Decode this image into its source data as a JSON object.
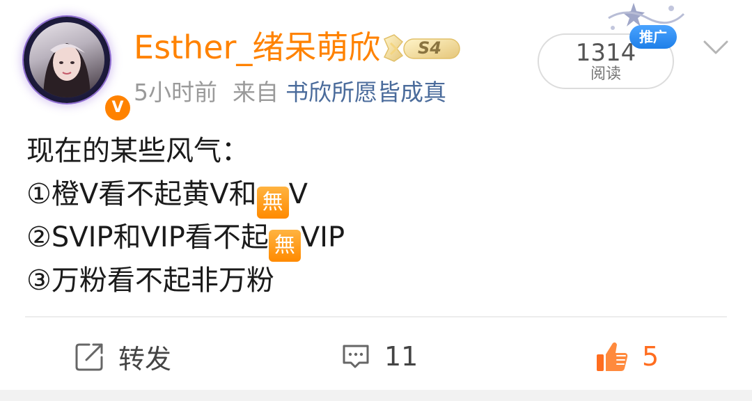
{
  "post": {
    "author": {
      "name": "Esther_绪呆萌欣",
      "level_badge": "S4",
      "verified_mark": "V"
    },
    "meta": {
      "time": "5小时前",
      "from_label": "来自",
      "source_app": "书欣所愿皆成真"
    },
    "reads": {
      "count": "1314",
      "label": "阅读"
    },
    "promo_badge": "推广",
    "body": {
      "line1": "现在的某些风气：",
      "line2_a": "①橙V看不起黄V和",
      "line2_b": "V",
      "line3_a": "②SVIP和VIP看不起",
      "line3_b": "VIP",
      "line4": "③万粉看不起非万粉",
      "emoji_char": "無"
    },
    "actions": {
      "repost_label": "转发",
      "comment_count": "11",
      "like_count": "5"
    }
  },
  "colors": {
    "username": "#ff8200",
    "accent_orange": "#ff6d1f",
    "link_blue": "#4a6b9b",
    "promo_blue": "#1f7fe8"
  },
  "icons": [
    "chevron-down-icon",
    "repost-icon",
    "comment-icon",
    "thumbs-up-icon",
    "verified-icon"
  ]
}
